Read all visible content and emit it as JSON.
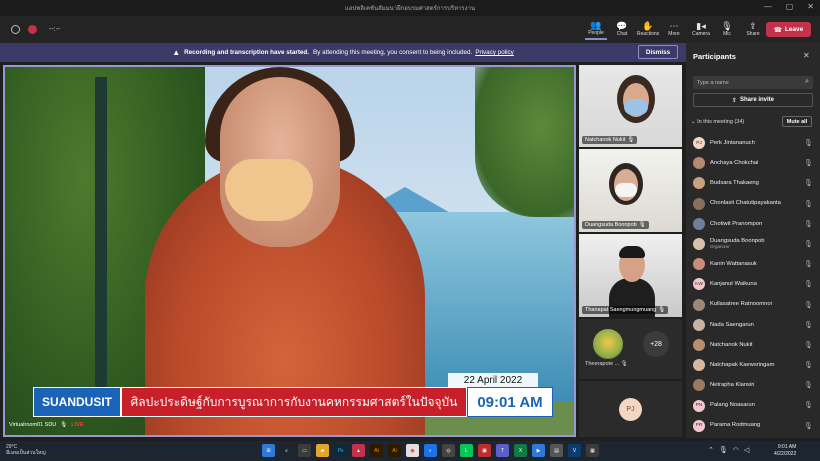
{
  "window": {
    "title": "แอปพลิเคชันสัมมนาฝึกอบรมศาสตร์การบริหารงาน",
    "controls": [
      "—",
      "▢",
      "✕"
    ]
  },
  "toolbar": {
    "timer": "--:--",
    "people_label": "People",
    "chat_label": "Chat",
    "reactions_label": "Reactions",
    "more_label": "More",
    "camera_label": "Camera",
    "mic_label": "Mic",
    "share_label": "Share",
    "leave_label": "Leave"
  },
  "banner": {
    "bold_text": "Recording and transcription have started.",
    "text": "By attending this meeting, you consent to being included.",
    "link": "Privacy policy",
    "dismiss_label": "Dismiss"
  },
  "main_video": {
    "date": "22 April 2022",
    "brand": "SUANDUSIT",
    "headline": "ศิลปะประดิษฐ์กับการบูรณาการกับงานคหกรรมศาสตร์ในปัจจุบัน",
    "time": "09:01 AM",
    "participant_name": "Virtualroom01 SDU",
    "live_label": "LIVE"
  },
  "tiles": [
    {
      "name": "Natchanok Nukit"
    },
    {
      "name": "Duangsuda Boonpob"
    },
    {
      "name": "Thanapat Saengmungmuang"
    },
    {
      "name": "Theerapote ...",
      "more_count": "+28"
    },
    {
      "initials": "PJ"
    }
  ],
  "participants_panel": {
    "title": "Participants",
    "search_placeholder": "Type a name",
    "share_invite_label": "Share invite",
    "section_label": "In this meeting (34)",
    "mute_all_label": "Mute all",
    "people": [
      {
        "name": "Perk Jintananuch",
        "initials": "PJ",
        "color": "#f3d6c3"
      },
      {
        "name": "Anchaya Chokchai",
        "initials": "",
        "color": "#b58a6e"
      },
      {
        "name": "Budsara Thakaeng",
        "initials": "",
        "color": "#c9a27e"
      },
      {
        "name": "Chonlasit Chatutipayakanta",
        "initials": "",
        "color": "#8a6e5a"
      },
      {
        "name": "Chotiwit Pranompon",
        "initials": "",
        "color": "#6e7f9a"
      },
      {
        "name": "Duangsuda Boonpob",
        "role": "Organizer",
        "initials": "",
        "color": "#d8c2aa"
      },
      {
        "name": "Kanin Wattanasuk",
        "initials": "",
        "color": "#c98d7a"
      },
      {
        "name": "Kanjanut Waikuna",
        "initials": "KW",
        "color": "#f1c8c8"
      },
      {
        "name": "Kullasatree Ratnoomnoi",
        "initials": "",
        "color": "#a08878"
      },
      {
        "name": "Nada Saengarun",
        "initials": "",
        "color": "#c7b3a4"
      },
      {
        "name": "Natchanok Nukit",
        "initials": "",
        "color": "#b89070"
      },
      {
        "name": "Natchapak Kaewsringam",
        "initials": "",
        "color": "#d6b8a0"
      },
      {
        "name": "Netrapha Klansiri",
        "initials": "",
        "color": "#9a7a60"
      },
      {
        "name": "Palang Noasarun",
        "initials": "PN",
        "color": "#f4c6d0"
      },
      {
        "name": "Parama Rodmuang",
        "initials": "PR",
        "color": "#f4c6d0"
      }
    ]
  },
  "taskbar": {
    "weather_temp": "29°C",
    "weather_desc": "มีเมฆเป็นส่วนใหญ่",
    "time": "9:01 AM",
    "date": "4/22/2022"
  }
}
